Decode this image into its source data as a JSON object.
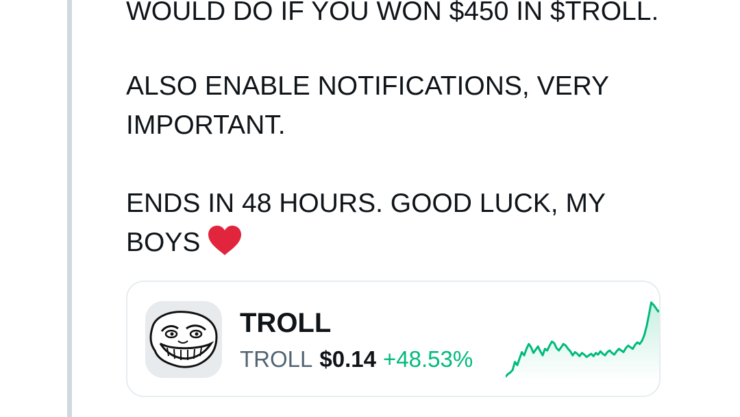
{
  "tweet": {
    "lines": [
      "WOULD DO IF YOU WON $450 IN $TROLL.",
      "ALSO ENABLE NOTIFICATIONS, VERY",
      "IMPORTANT.",
      "ENDS IN 48 HOURS. GOOD LUCK, MY",
      "BOYS"
    ],
    "emoji": "red-heart-emoji"
  },
  "token_card": {
    "name": "TROLL",
    "symbol": "TROLL",
    "price": "$0.14",
    "change": "+48.53%",
    "avatar_icon": "troll-face-icon",
    "colors": {
      "positive": "#00ba7c",
      "heart": "#e0253d"
    },
    "sparkline": [
      4,
      7,
      9,
      12,
      22,
      18,
      26,
      34,
      30,
      38,
      44,
      40,
      33,
      37,
      41,
      35,
      30,
      38,
      36,
      42,
      47,
      45,
      39,
      36,
      40,
      44,
      42,
      38,
      35,
      30,
      34,
      32,
      29,
      33,
      31,
      28,
      30,
      32,
      29,
      33,
      31,
      35,
      32,
      30,
      34,
      36,
      33,
      31,
      35,
      38,
      36,
      34,
      39,
      42,
      40,
      38,
      43,
      46,
      44,
      48,
      55,
      66,
      80,
      95,
      92,
      88,
      84,
      86
    ]
  }
}
